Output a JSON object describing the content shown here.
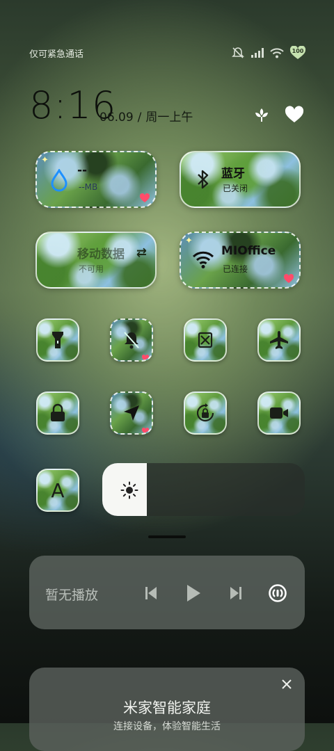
{
  "status_bar": {
    "carrier": "仅可紧急通话",
    "battery_level": "100",
    "icons": [
      "mute-icon",
      "signal-icon",
      "wifi-icon",
      "battery-heart-icon"
    ]
  },
  "header": {
    "time": "8:16",
    "date": "06.09",
    "separator": "/",
    "weekday_period": "周一上午",
    "buttons": [
      "edit-flower-icon",
      "favorite-heart-icon"
    ]
  },
  "tiles_big": [
    {
      "name": "data-tile",
      "title": "--",
      "subtitle": "--MB",
      "icon": "water-drop-icon",
      "active": true,
      "accent": "#1e90ff"
    },
    {
      "name": "bluetooth-tile",
      "title": "蓝牙",
      "subtitle": "已关闭",
      "icon": "bluetooth-icon",
      "active": false
    },
    {
      "name": "mobile-data-tile",
      "title": "移动数据",
      "subtitle": "不可用",
      "icon": "none",
      "active": false
    },
    {
      "name": "wifi-tile",
      "title": "MIOffice",
      "subtitle": "已连接",
      "icon": "wifi-icon",
      "active": true
    }
  ],
  "tiles_small": [
    {
      "name": "flashlight",
      "icon": "flashlight-icon",
      "active": false
    },
    {
      "name": "mute",
      "icon": "bell-off-icon",
      "active": true
    },
    {
      "name": "screenshot",
      "icon": "scissors-icon",
      "active": false
    },
    {
      "name": "airplane-mode",
      "icon": "airplane-icon",
      "active": false
    },
    {
      "name": "screen-lock",
      "icon": "lock-icon",
      "active": false
    },
    {
      "name": "location",
      "icon": "navigation-icon",
      "active": true
    },
    {
      "name": "rotation-lock",
      "icon": "rotation-lock-icon",
      "active": false
    },
    {
      "name": "screen-record",
      "icon": "video-camera-icon",
      "active": false
    },
    {
      "name": "font-size",
      "icon": "letter-a-icon",
      "label": "A",
      "active": false
    }
  ],
  "brightness": {
    "level": 0.22
  },
  "media": {
    "status": "暂无播放",
    "controls": [
      "previous-icon",
      "play-icon",
      "next-icon",
      "cast-icon"
    ]
  },
  "home_card": {
    "title": "米家智能家庭",
    "subtitle": "连接设备，体验智能生活"
  }
}
